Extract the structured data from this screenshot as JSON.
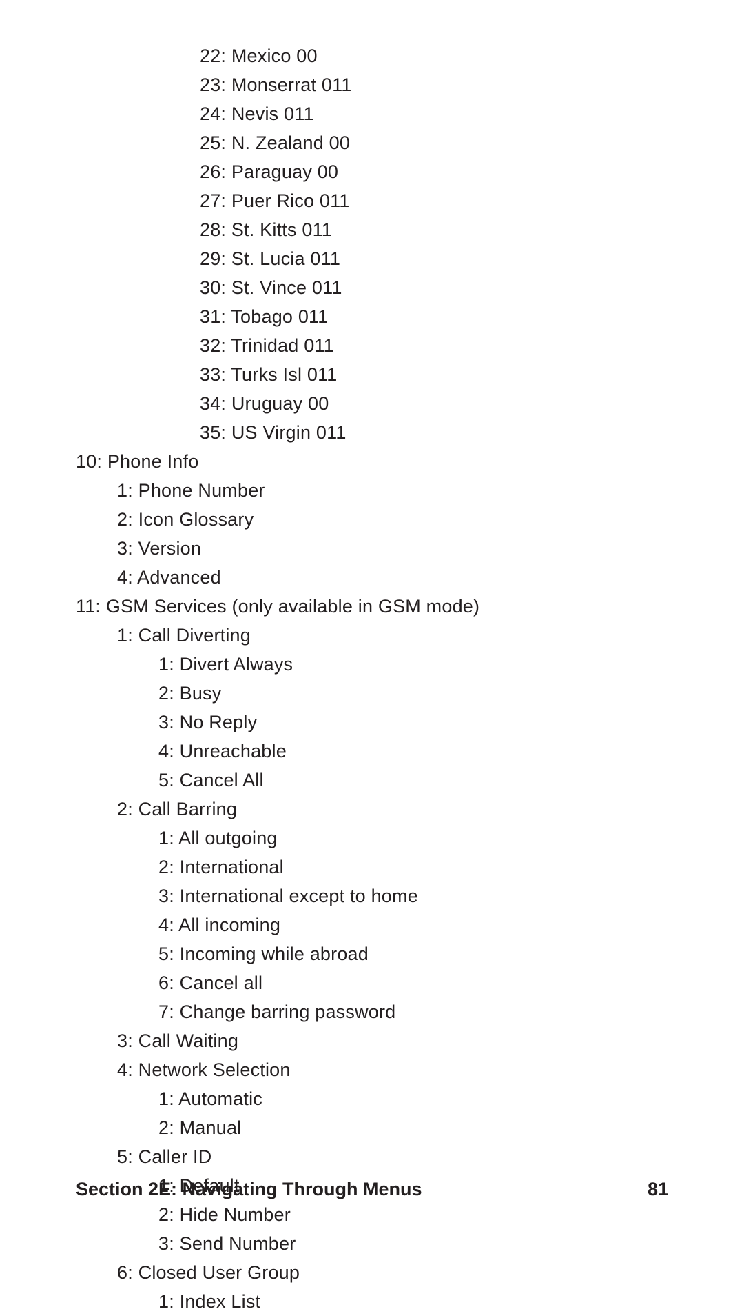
{
  "lines": [
    {
      "indent": 3,
      "text": "22: Mexico 00"
    },
    {
      "indent": 3,
      "text": "23: Monserrat 011"
    },
    {
      "indent": 3,
      "text": "24: Nevis 011"
    },
    {
      "indent": 3,
      "text": "25: N. Zealand 00"
    },
    {
      "indent": 3,
      "text": "26: Paraguay 00"
    },
    {
      "indent": 3,
      "text": "27: Puer Rico 011"
    },
    {
      "indent": 3,
      "text": "28: St. Kitts 011"
    },
    {
      "indent": 3,
      "text": "29: St. Lucia 011"
    },
    {
      "indent": 3,
      "text": "30: St. Vince 011"
    },
    {
      "indent": 3,
      "text": "31: Tobago 011"
    },
    {
      "indent": 3,
      "text": "32: Trinidad 011"
    },
    {
      "indent": 3,
      "text": "33: Turks Isl 011"
    },
    {
      "indent": 3,
      "text": "34: Uruguay 00"
    },
    {
      "indent": 3,
      "text": "35: US Virgin 011"
    },
    {
      "indent": 0,
      "text": "10: Phone Info"
    },
    {
      "indent": 1,
      "text": "1: Phone Number"
    },
    {
      "indent": 1,
      "text": "2: Icon Glossary"
    },
    {
      "indent": 1,
      "text": "3: Version"
    },
    {
      "indent": 1,
      "text": "4: Advanced"
    },
    {
      "indent": 0,
      "text": "11: GSM Services (only available in GSM mode)"
    },
    {
      "indent": 1,
      "text": "1: Call Diverting"
    },
    {
      "indent": 2,
      "text": "1: Divert Always"
    },
    {
      "indent": 2,
      "text": "2: Busy"
    },
    {
      "indent": 2,
      "text": "3: No Reply"
    },
    {
      "indent": 2,
      "text": "4: Unreachable"
    },
    {
      "indent": 2,
      "text": "5: Cancel All"
    },
    {
      "indent": 1,
      "text": "2: Call Barring"
    },
    {
      "indent": 2,
      "text": "1: All outgoing"
    },
    {
      "indent": 2,
      "text": "2: International"
    },
    {
      "indent": 2,
      "text": "3: International except to home"
    },
    {
      "indent": 2,
      "text": "4: All incoming"
    },
    {
      "indent": 2,
      "text": "5: Incoming while abroad"
    },
    {
      "indent": 2,
      "text": "6: Cancel all"
    },
    {
      "indent": 2,
      "text": "7: Change barring password"
    },
    {
      "indent": 1,
      "text": "3: Call Waiting"
    },
    {
      "indent": 1,
      "text": "4: Network Selection"
    },
    {
      "indent": 2,
      "text": "1: Automatic"
    },
    {
      "indent": 2,
      "text": "2: Manual"
    },
    {
      "indent": 1,
      "text": "5: Caller ID"
    },
    {
      "indent": 2,
      "text": "1: Default"
    },
    {
      "indent": 2,
      "text": "2: Hide Number"
    },
    {
      "indent": 2,
      "text": "3: Send Number"
    },
    {
      "indent": 1,
      "text": "6: Closed User Group"
    },
    {
      "indent": 2,
      "text": "1: Index List"
    }
  ],
  "footer": {
    "section": "Section 2E: Navigating Through Menus",
    "page": "81"
  }
}
